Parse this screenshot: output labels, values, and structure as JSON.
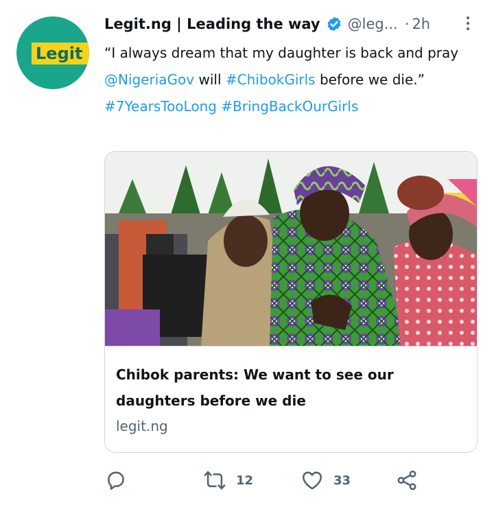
{
  "tweet": {
    "avatar_text": "Legit",
    "author_name": "Legit.ng | Leading the way",
    "handle": "@leg...",
    "separator": "·",
    "time": "2h",
    "text_part1": "“I always dream that my daughter is back and pray ",
    "mention": "@NigeriaGov",
    "text_part2": " will ",
    "hashtag1": "#ChibokGirls",
    "text_part3": " before we die.”",
    "hashtag2": "#7YearsTooLong",
    "hashtag_space": " ",
    "hashtag3": "#BringBackOurGirls"
  },
  "card": {
    "title": "Chibok parents: We want to see our daughters before we die",
    "domain": "legit.ng"
  },
  "actions": {
    "reply_count": "",
    "retweet_count": "12",
    "like_count": "33"
  },
  "colors": {
    "link": "#1d9bf0",
    "verified": "#1d9bf0",
    "avatar_bg": "#1aa68a",
    "logo_yellow": "#f7d21b"
  },
  "icons": [
    "verified-badge-icon",
    "more-icon",
    "reply-icon",
    "retweet-icon",
    "like-icon",
    "share-icon"
  ]
}
